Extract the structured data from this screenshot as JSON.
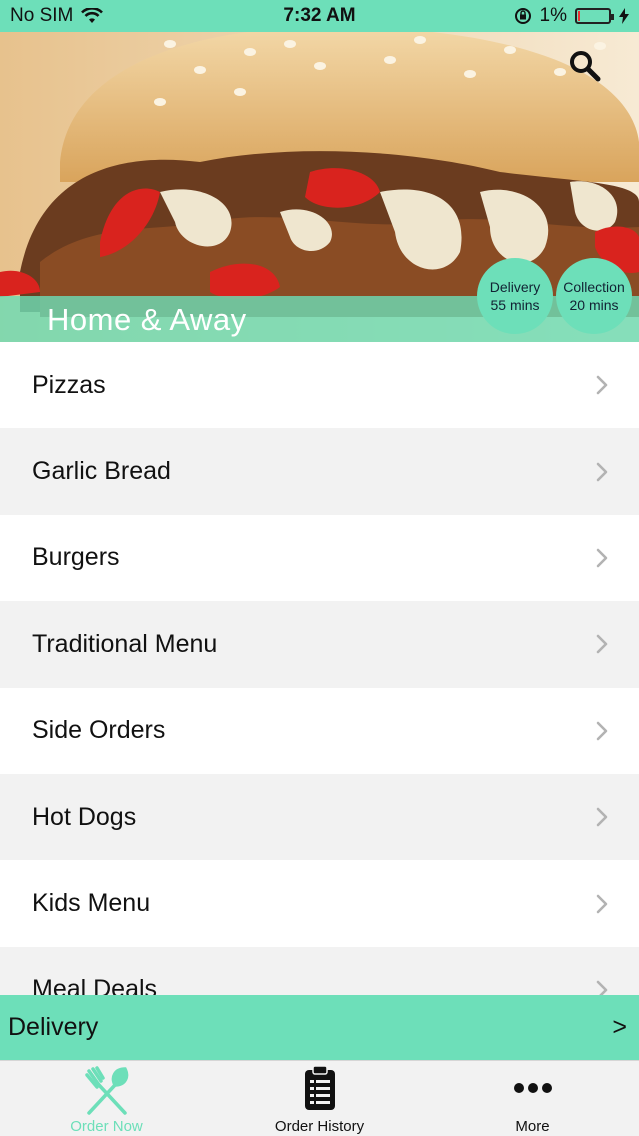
{
  "status_bar": {
    "carrier": "No SIM",
    "time": "7:32 AM",
    "battery": "1%"
  },
  "restaurant": {
    "name": "Home & Away"
  },
  "badges": {
    "delivery": {
      "label": "Delivery",
      "time": "55 mins"
    },
    "collection": {
      "label": "Collection",
      "time": "20 mins"
    }
  },
  "menu": [
    {
      "label": "Pizzas"
    },
    {
      "label": "Garlic Bread"
    },
    {
      "label": "Burgers"
    },
    {
      "label": "Traditional Menu"
    },
    {
      "label": "Side Orders"
    },
    {
      "label": "Hot Dogs"
    },
    {
      "label": "Kids Menu"
    },
    {
      "label": "Meal Deals"
    }
  ],
  "order_bar": {
    "mode": "Delivery",
    "arrow": ">"
  },
  "tabs": [
    {
      "label": "Order Now",
      "icon": "fork-knife-icon"
    },
    {
      "label": "Order History",
      "icon": "clipboard-icon"
    },
    {
      "label": "More",
      "icon": "more-dots-icon"
    }
  ],
  "colors": {
    "accent": "#6ddfb9",
    "row_alt": "#f2f2f2"
  }
}
